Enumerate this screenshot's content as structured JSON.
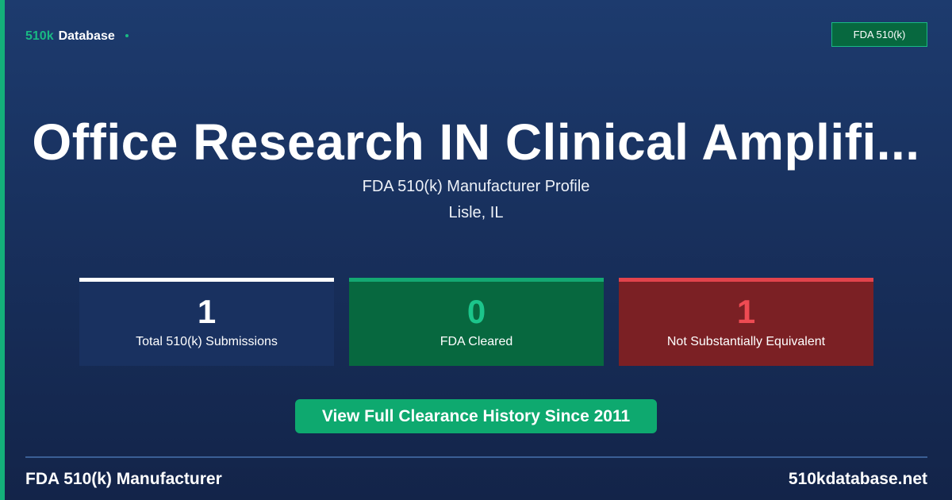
{
  "brand": {
    "prefix": "510k",
    "name": "Database"
  },
  "badge": "FDA 510(k)",
  "title": "Office Research IN Clinical Amplifi...",
  "subtitle": "FDA 510(k) Manufacturer Profile",
  "location": "Lisle, IL",
  "stats": [
    {
      "value": "1",
      "label": "Total 510(k) Submissions"
    },
    {
      "value": "0",
      "label": "FDA Cleared"
    },
    {
      "value": "1",
      "label": "Not Substantially Equivalent"
    }
  ],
  "cta": "View Full Clearance History Since 2011",
  "footer": {
    "left": "FDA 510(k) Manufacturer",
    "right": "510kdatabase.net"
  },
  "colors": {
    "background": "#1a3566",
    "accent": "#14b07a",
    "cleared": "#07683f",
    "not_equivalent": "#7b2024"
  }
}
